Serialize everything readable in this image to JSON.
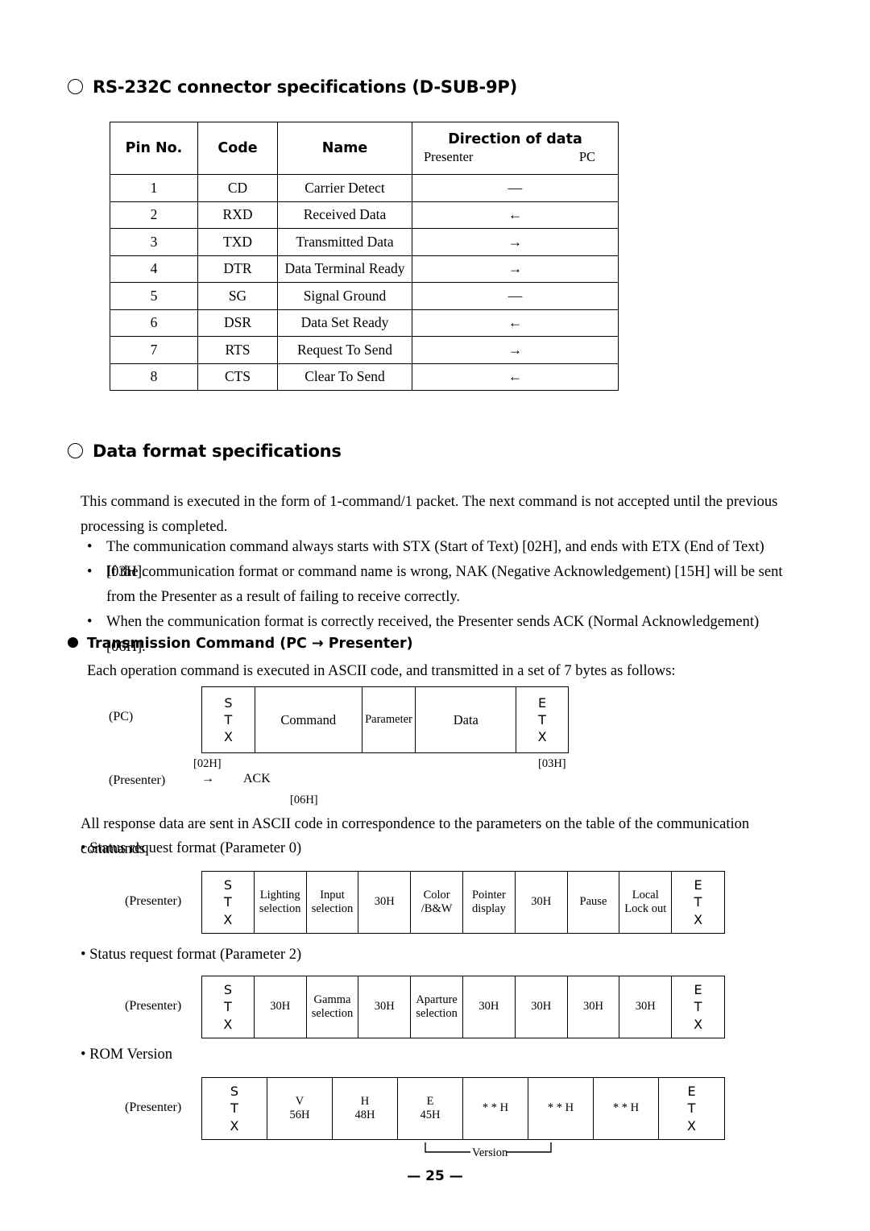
{
  "document": {
    "page_number": "— 25 —"
  },
  "section1": {
    "heading": "RS-232C connector specifications (D-SUB-9P)",
    "table": {
      "headers": {
        "pin_no": "Pin No.",
        "code": "Code",
        "name": "Name",
        "direction": "Direction of data",
        "dir_left": "Presenter",
        "dir_right": "PC"
      },
      "rows": [
        {
          "pin": "1",
          "code": "CD",
          "name": "Carrier Detect",
          "dir": "—"
        },
        {
          "pin": "2",
          "code": "RXD",
          "name": "Received Data",
          "dir": "←"
        },
        {
          "pin": "3",
          "code": "TXD",
          "name": "Transmitted Data",
          "dir": "→"
        },
        {
          "pin": "4",
          "code": "DTR",
          "name": "Data Terminal Ready",
          "dir": "→"
        },
        {
          "pin": "5",
          "code": "SG",
          "name": "Signal Ground",
          "dir": "—"
        },
        {
          "pin": "6",
          "code": "DSR",
          "name": "Data Set Ready",
          "dir": "←"
        },
        {
          "pin": "7",
          "code": "RTS",
          "name": "Request To Send",
          "dir": "→"
        },
        {
          "pin": "8",
          "code": "CTS",
          "name": "Clear To Send",
          "dir": "←"
        }
      ]
    }
  },
  "section2": {
    "heading": "Data format specifications",
    "intro": "This command is executed in the form of 1-command/1 packet.  The next command is not accepted until the previous processing is completed.",
    "bullets": [
      {
        "mark": "•",
        "text": "The communication command always starts with STX (Start of Text) [02H], and ends with ETX (End of Text) [03H]."
      },
      {
        "mark": "•",
        "text": "If the communication format or command name is wrong, NAK (Negative Acknowledgement) [15H] will be sent from the Presenter as a result of failing to receive correctly."
      },
      {
        "mark": "•",
        "text": "When the communication format is correctly received, the Presenter sends ACK (Normal Acknowledgement) [06H]."
      }
    ],
    "transmission": {
      "heading": "Transmission Command (PC → Presenter)",
      "description": "Each operation command is executed in ASCII code, and transmitted in a set of 7 bytes as follows:",
      "pc_label": "(PC)",
      "presenter_label": "(Presenter)",
      "response_arrow": "→",
      "ack_label": "ACK",
      "stx_code": "[02H]",
      "etx_code": "[03H]",
      "ack_code": "[06H]",
      "frame": [
        {
          "stack": "S\nT\nX",
          "text": ""
        },
        {
          "stack": "",
          "text": "Command"
        },
        {
          "stack": "",
          "text": "Parameter"
        },
        {
          "stack": "",
          "text": "Data"
        },
        {
          "stack": "E\nT\nX",
          "text": ""
        }
      ]
    },
    "response_note": "All response data are sent in ASCII code in correspondence to the parameters on the table of the communication commands.",
    "formats": [
      {
        "label": "• Status request format (Parameter 0)",
        "sender": "(Presenter)",
        "cells": [
          {
            "line1": "S",
            "line2": "T",
            "line3": "X"
          },
          {
            "line1": "Lighting",
            "line2": "selection",
            "line3": ""
          },
          {
            "line1": "Input",
            "line2": "selection",
            "line3": ""
          },
          {
            "line1": "30H",
            "line2": "",
            "line3": ""
          },
          {
            "line1": "Color",
            "line2": "/B&W",
            "line3": ""
          },
          {
            "line1": "Pointer",
            "line2": "display",
            "line3": ""
          },
          {
            "line1": "30H",
            "line2": "",
            "line3": ""
          },
          {
            "line1": "Pause",
            "line2": "",
            "line3": ""
          },
          {
            "line1": "Local",
            "line2": "Lock out",
            "line3": ""
          },
          {
            "line1": "E",
            "line2": "T",
            "line3": "X"
          }
        ]
      },
      {
        "label": "• Status request format (Parameter 2)",
        "sender": "(Presenter)",
        "cells": [
          {
            "line1": "S",
            "line2": "T",
            "line3": "X"
          },
          {
            "line1": "30H",
            "line2": "",
            "line3": ""
          },
          {
            "line1": "Gamma",
            "line2": "selection",
            "line3": ""
          },
          {
            "line1": "30H",
            "line2": "",
            "line3": ""
          },
          {
            "line1": "Aparture",
            "line2": "selection",
            "line3": ""
          },
          {
            "line1": "30H",
            "line2": "",
            "line3": ""
          },
          {
            "line1": "30H",
            "line2": "",
            "line3": ""
          },
          {
            "line1": "30H",
            "line2": "",
            "line3": ""
          },
          {
            "line1": "30H",
            "line2": "",
            "line3": ""
          },
          {
            "line1": "E",
            "line2": "T",
            "line3": "X"
          }
        ]
      },
      {
        "label": "• ROM Version",
        "sender": "(Presenter)",
        "version_brace_label": "Version",
        "cells": [
          {
            "line1": "S",
            "line2": "T",
            "line3": "X"
          },
          {
            "line1": "V",
            "line2": "56H",
            "line3": ""
          },
          {
            "line1": "H",
            "line2": "48H",
            "line3": ""
          },
          {
            "line1": "E",
            "line2": "45H",
            "line3": ""
          },
          {
            "line1": "* * H",
            "line2": "",
            "line3": ""
          },
          {
            "line1": "* * H",
            "line2": "",
            "line3": ""
          },
          {
            "line1": "* * H",
            "line2": "",
            "line3": ""
          },
          {
            "line1": "E",
            "line2": "T",
            "line3": "X"
          }
        ]
      }
    ]
  }
}
